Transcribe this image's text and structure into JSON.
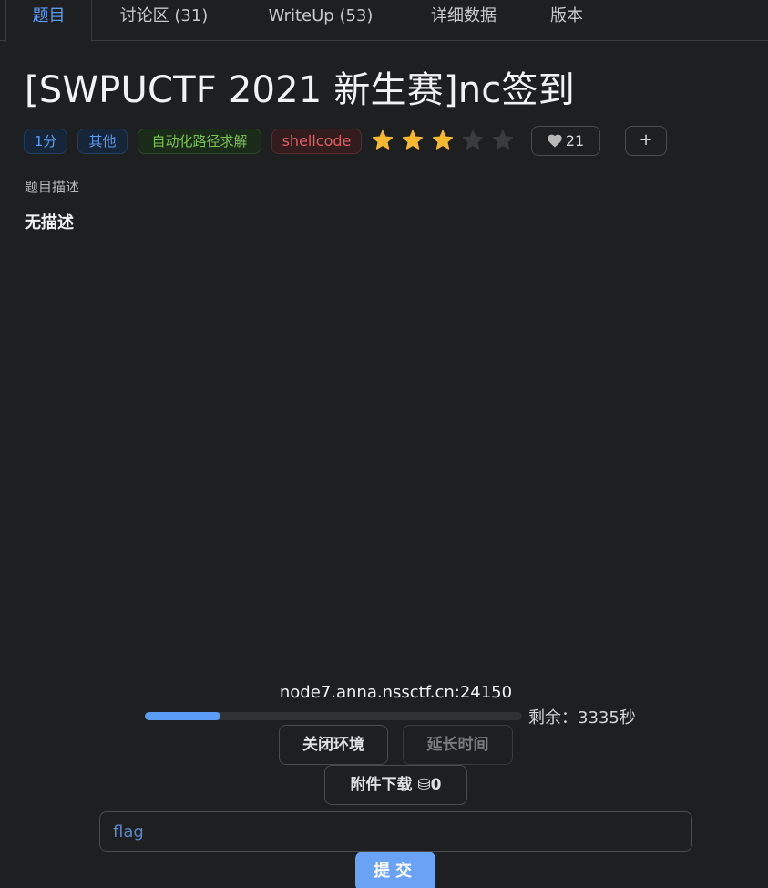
{
  "tabs": [
    {
      "label": "题目",
      "active": true
    },
    {
      "label": "讨论区 (31)"
    },
    {
      "label": "WriteUp (53)"
    },
    {
      "label": "详细数据"
    },
    {
      "label": "版本"
    }
  ],
  "title": "[SWPUCTF 2021 新生赛]nc签到",
  "tags": [
    {
      "label": "1分",
      "color": "blue"
    },
    {
      "label": "其他",
      "color": "blue"
    },
    {
      "label": "自动化路径求解",
      "color": "green"
    },
    {
      "label": "shellcode",
      "color": "red"
    }
  ],
  "rating": {
    "filled": 3,
    "total": 5,
    "filled_color": "#f5b82e",
    "empty_color": "#3a3b3e"
  },
  "likes": {
    "count": "21",
    "icon": "heart-icon"
  },
  "add_label": "+",
  "description": {
    "label": "题目描述",
    "text": "无描述"
  },
  "instance": {
    "address": "node7.anna.nssctf.cn:24150",
    "progress": 0.2,
    "remaining": "剩余：3335秒"
  },
  "buttons": {
    "close_env": "关闭环境",
    "extend_time": "延长时间",
    "download": "附件下载 ⛁0"
  },
  "flag_input": {
    "placeholder": "flag",
    "value": ""
  },
  "submit_label": "提交",
  "colors": {
    "accent": "#5b9cf5",
    "background": "#1e1f21"
  }
}
